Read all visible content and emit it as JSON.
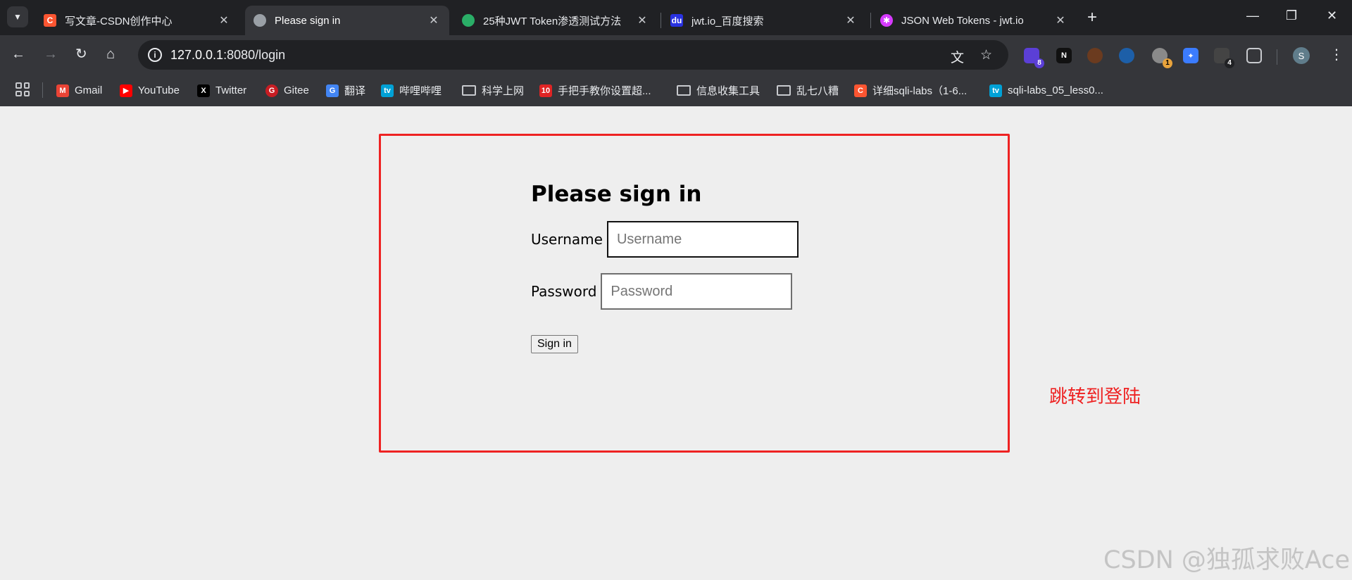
{
  "browser": {
    "tabs": [
      {
        "title": "写文章-CSDN创作中心",
        "favicon": "csdn-icon",
        "active": false,
        "color": "#fc5531"
      },
      {
        "title": "Please sign in",
        "favicon": "globe-icon",
        "active": true,
        "color": "#9aa0a6"
      },
      {
        "title": "25种JWT Token渗透测试方法",
        "favicon": "wechat-icon",
        "active": false,
        "color": "#2aae67"
      },
      {
        "title": "jwt.io_百度搜索",
        "favicon": "baidu-icon",
        "active": false,
        "color": "#2932e1"
      },
      {
        "title": "JSON Web Tokens - jwt.io",
        "favicon": "jwt-icon",
        "active": false,
        "color": "#d63aff"
      }
    ],
    "address": {
      "host": "127.0.0.1",
      "rest": ":8080/login"
    },
    "extensions": [
      {
        "name": "extension-purple-icon",
        "badge": "8",
        "color": "#5b3fd6"
      },
      {
        "name": "extension-black-icon",
        "badge": "",
        "color": "#111111"
      },
      {
        "name": "extension-hacker-icon",
        "badge": "",
        "color": "#6b3b1f"
      },
      {
        "name": "extension-blue-icon",
        "badge": "",
        "color": "#1d5fa8"
      },
      {
        "name": "extension-gray-icon",
        "badge": "1",
        "color": "#8a8a8a"
      },
      {
        "name": "extension-bird-icon",
        "badge": "",
        "color": "#3b7cff"
      },
      {
        "name": "extension-page-icon",
        "badge": "4",
        "color": "#444444"
      }
    ],
    "profile_initial": "S",
    "bookmarks": [
      {
        "label": "Gmail",
        "icon": "gmail-icon",
        "color": "#ea4335",
        "folder": false
      },
      {
        "label": "YouTube",
        "icon": "youtube-icon",
        "color": "#ff0000",
        "folder": false
      },
      {
        "label": "Twitter",
        "icon": "twitter-icon",
        "color": "#000000",
        "folder": false
      },
      {
        "label": "Gitee",
        "icon": "gitee-icon",
        "color": "#c71d23",
        "folder": false
      },
      {
        "label": "翻译",
        "icon": "translate-icon",
        "color": "#4285f4",
        "folder": false
      },
      {
        "label": "哔哩哔哩",
        "icon": "bilibili-icon",
        "color": "#00a1d6",
        "folder": false
      },
      {
        "label": "科学上网",
        "icon": "folder-icon",
        "color": "",
        "folder": true
      },
      {
        "label": "手把手教你设置超...",
        "icon": "red-badge-icon",
        "color": "#e02424",
        "folder": false
      },
      {
        "label": "信息收集工具",
        "icon": "folder-icon",
        "color": "",
        "folder": true
      },
      {
        "label": "乱七八糟",
        "icon": "folder-icon",
        "color": "",
        "folder": true
      },
      {
        "label": "详细sqli-labs（1-6...",
        "icon": "csdn-icon",
        "color": "#fc5531",
        "folder": false
      },
      {
        "label": "sqli-labs_05_less0...",
        "icon": "bilibili-icon",
        "color": "#00a1d6",
        "folder": false
      }
    ]
  },
  "page": {
    "heading": "Please sign in",
    "username_label": "Username",
    "username_placeholder": "Username",
    "password_label": "Password",
    "password_placeholder": "Password",
    "submit_label": "Sign in"
  },
  "annotation": "跳转到登陆",
  "watermark": "CSDN @独孤求败Ace"
}
